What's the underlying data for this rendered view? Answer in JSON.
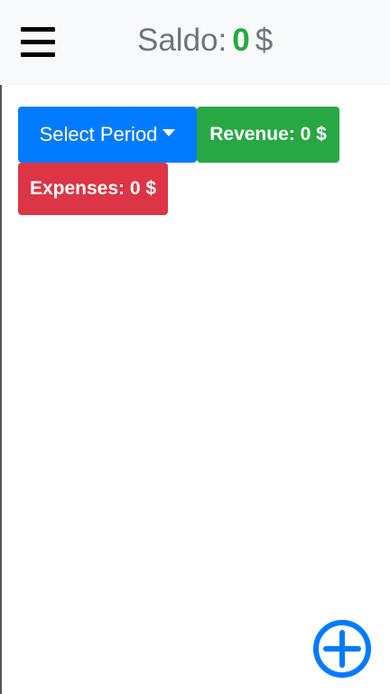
{
  "header": {
    "saldo_label": "Saldo:",
    "saldo_value": "0",
    "saldo_currency": "$",
    "menu_icon": "hamburger-menu-icon"
  },
  "controls": {
    "period_label": "Select Period",
    "revenue_label": "Revenue: 0 $",
    "expenses_label": "Expenses: 0 $"
  },
  "fab": {
    "icon": "add-circle-icon"
  },
  "colors": {
    "primary": "#007bff",
    "success": "#28a745",
    "danger": "#dc3545",
    "header_bg": "#f8f9fa",
    "muted_text": "#6c757d"
  }
}
